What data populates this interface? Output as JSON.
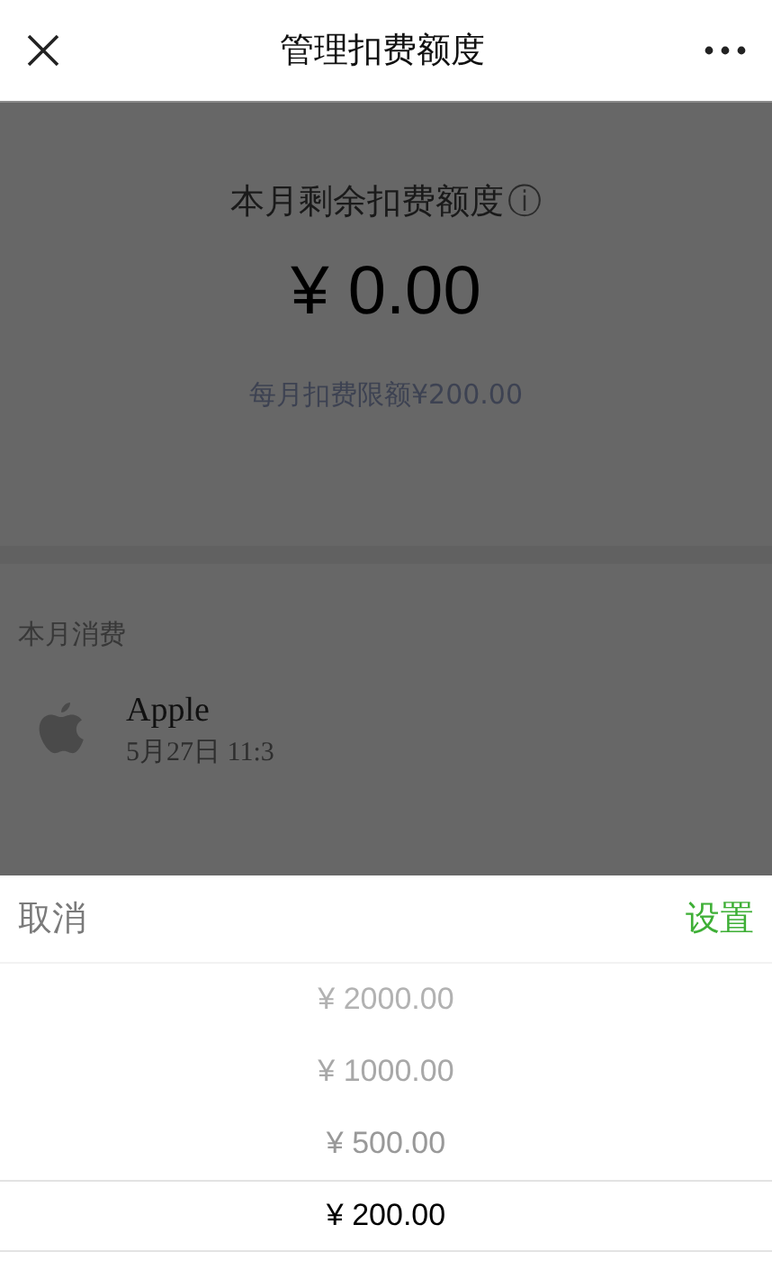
{
  "header": {
    "title": "管理扣费额度"
  },
  "summary": {
    "label": "本月剩余扣费额度",
    "info_icon": "ⓘ",
    "amount": "¥ 0.00",
    "limit": "每月扣费限额¥200.00"
  },
  "spending": {
    "title": "本月消费",
    "items": [
      {
        "merchant": "Apple",
        "time": "5月27日 11:3"
      }
    ]
  },
  "sheet": {
    "cancel": "取消",
    "confirm": "设置",
    "options": [
      {
        "label": "¥ 2000.00",
        "selected": false
      },
      {
        "label": "¥ 1000.00",
        "selected": false
      },
      {
        "label": "¥ 500.00",
        "selected": false
      },
      {
        "label": "¥ 200.00",
        "selected": true
      }
    ]
  }
}
